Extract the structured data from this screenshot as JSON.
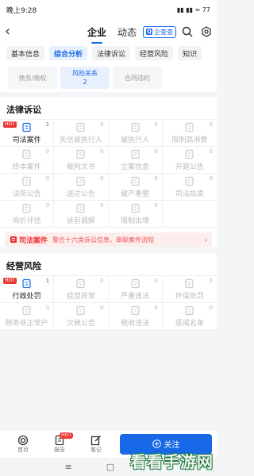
{
  "status": {
    "time": "晚上9:28",
    "icons": "▮▮ ▮▮ ≈ 77"
  },
  "header": {
    "back": "‹",
    "tabs": [
      "企业",
      "动态"
    ],
    "qcc": "企查查",
    "qcc_mark": "Q"
  },
  "tabs": [
    "基本信息",
    "综合分析",
    "法律诉讼",
    "经营风险",
    "知识"
  ],
  "subtabs": [
    {
      "label": "债务/债权",
      "count": ""
    },
    {
      "label": "风险关系",
      "count": "2"
    },
    {
      "label": "合同违约",
      "count": ""
    }
  ],
  "legal": {
    "title": "法律诉讼",
    "cells": [
      {
        "label": "司法案件",
        "count": "1",
        "on": true,
        "hot": "HOT"
      },
      {
        "label": "失信被执行人",
        "count": "0",
        "on": false
      },
      {
        "label": "被执行人",
        "count": "0",
        "on": false
      },
      {
        "label": "限制高消费",
        "count": "0",
        "on": false
      },
      {
        "label": "终本案件",
        "count": "0",
        "on": false
      },
      {
        "label": "裁判文书",
        "count": "0",
        "on": false
      },
      {
        "label": "立案信息",
        "count": "0",
        "on": false
      },
      {
        "label": "开庭公告",
        "count": "0",
        "on": false
      },
      {
        "label": "法院公告",
        "count": "0",
        "on": false
      },
      {
        "label": "送达公告",
        "count": "0",
        "on": false
      },
      {
        "label": "破产重整",
        "count": "0",
        "on": false
      },
      {
        "label": "司法拍卖",
        "count": "0",
        "on": false
      },
      {
        "label": "询价评估",
        "count": "0",
        "on": false
      },
      {
        "label": "诉前调解",
        "count": "0",
        "on": false
      },
      {
        "label": "限制出境",
        "count": "0",
        "on": false
      },
      {
        "label": "",
        "count": "",
        "on": false
      }
    ],
    "banner_tag": "司法案件",
    "banner_desc": "聚合十六类诉讼信息，串联案件流程",
    "banner_arrow": "›"
  },
  "risk": {
    "title": "经营风险",
    "cells": [
      {
        "label": "行政处罚",
        "count": "1",
        "on": true,
        "hot": "HOT"
      },
      {
        "label": "经营异常",
        "count": "0",
        "on": false
      },
      {
        "label": "严重违法",
        "count": "0",
        "on": false
      },
      {
        "label": "环保处罚",
        "count": "0",
        "on": false
      },
      {
        "label": "税务非正常户",
        "count": "0",
        "on": false
      },
      {
        "label": "欠税公告",
        "count": "0",
        "on": false
      },
      {
        "label": "税收违法",
        "count": "0",
        "on": false
      },
      {
        "label": "惩戒名单",
        "count": "0",
        "on": false
      }
    ]
  },
  "bottom": {
    "items": [
      {
        "label": "首页",
        "badge": ""
      },
      {
        "label": "报告",
        "badge": "HOT"
      },
      {
        "label": "笔记",
        "badge": ""
      }
    ],
    "follow": "关注"
  },
  "nav": [
    "≡",
    "▢",
    "‹"
  ],
  "watermark": "看看手游网",
  "colors": {
    "accent": "#1768e6",
    "danger": "#ee3333"
  }
}
